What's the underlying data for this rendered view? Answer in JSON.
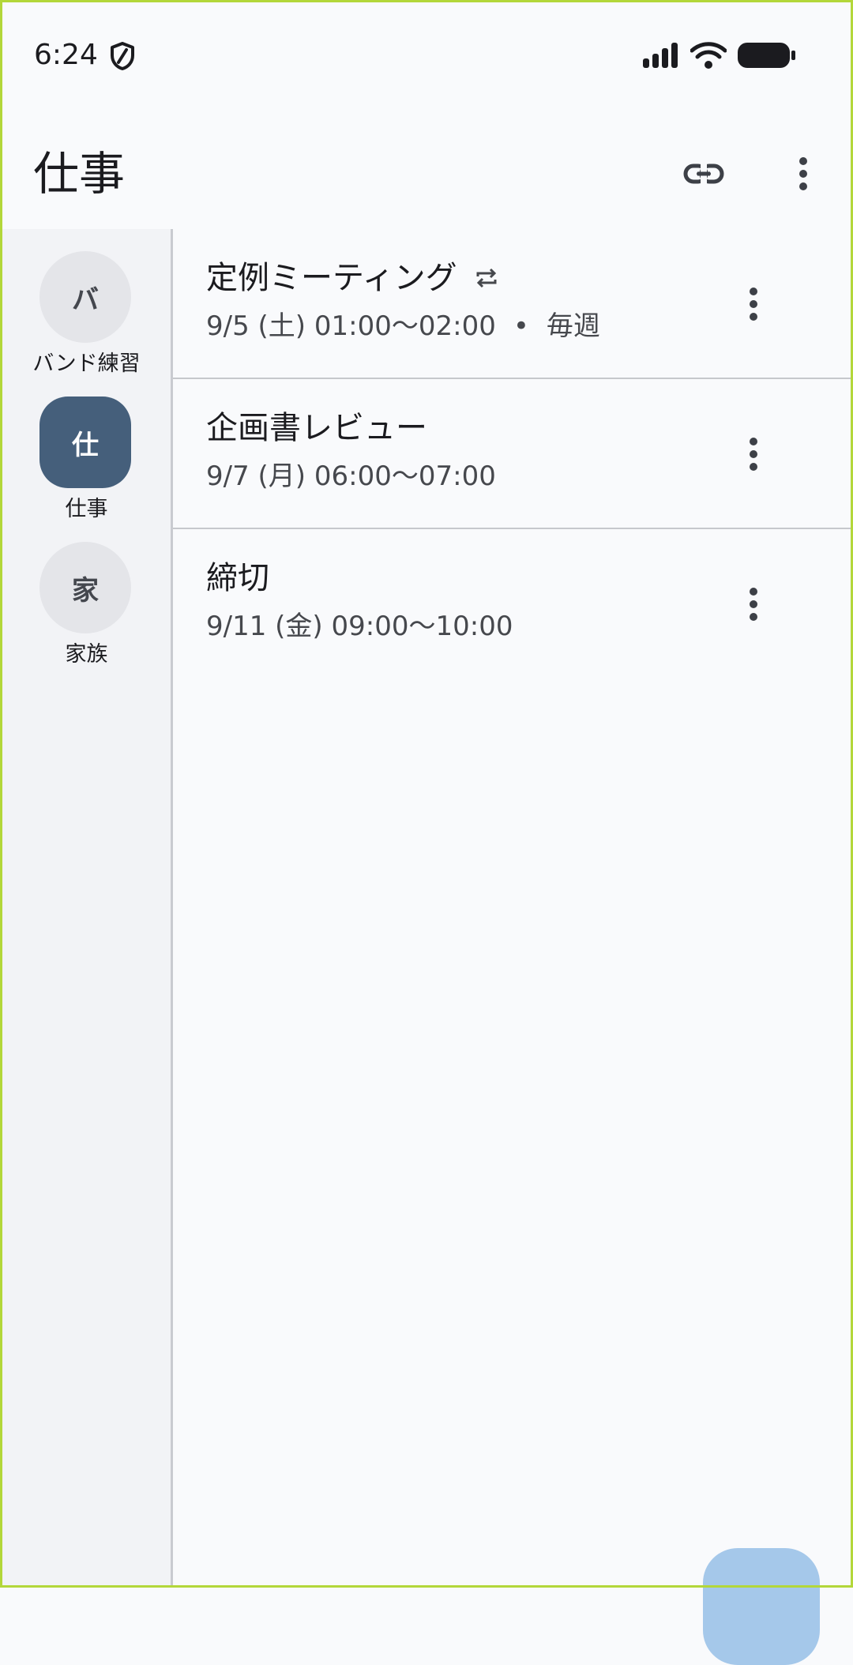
{
  "status_bar": {
    "time": "6:24",
    "icons": [
      "shield-icon",
      "signal-icon",
      "wifi-icon",
      "battery-icon"
    ]
  },
  "app_bar": {
    "title": "仕事",
    "actions": [
      "link-icon",
      "more-vert-icon"
    ]
  },
  "sidebar": {
    "items": [
      {
        "initial": "バ",
        "label": "バンド練習",
        "selected": false
      },
      {
        "initial": "仕",
        "label": "仕事",
        "selected": true
      },
      {
        "initial": "家",
        "label": "家族",
        "selected": false
      }
    ]
  },
  "events": [
    {
      "title": "定例ミーティング",
      "repeat_icon": "repeat-icon",
      "datetime": "9/5 (土) 01:00〜02:00",
      "separator": "•",
      "recurrence": "毎週"
    },
    {
      "title": "企画書レビュー",
      "datetime": "9/7 (月) 06:00〜07:00"
    },
    {
      "title": "締切",
      "datetime": "9/11 (金) 09:00〜10:00"
    }
  ],
  "colors": {
    "background": "#f9fafc",
    "sidebar_bg": "#f2f3f6",
    "selected_avatar": "#455f7b",
    "unselected_avatar": "#e4e5e9",
    "fab": "#a5c8ea",
    "frame_border": "#b3d73a"
  }
}
